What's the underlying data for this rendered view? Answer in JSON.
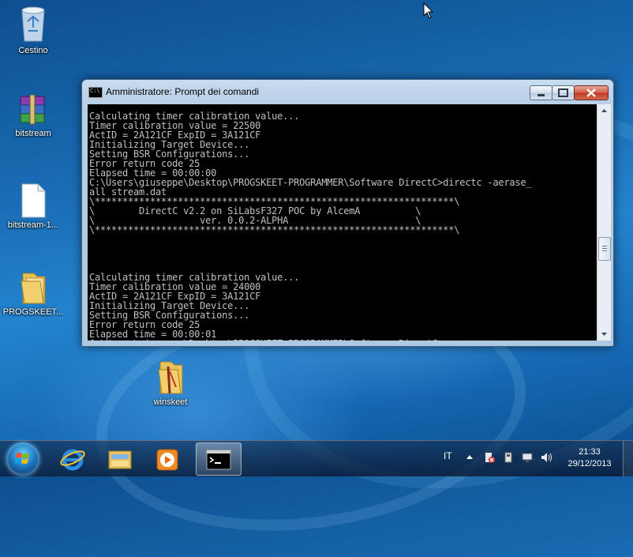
{
  "desktop": {
    "icons": [
      {
        "label": "Cestino",
        "icon": "recycle-bin-icon"
      },
      {
        "label": "bitstream",
        "icon": "winrar-archive-icon"
      },
      {
        "label": "bitstream-1...",
        "icon": "file-icon"
      },
      {
        "label": "PROGSKEET...",
        "icon": "folder-icon"
      },
      {
        "label": "winskeet",
        "icon": "zipped-folder-icon"
      }
    ]
  },
  "window": {
    "title": "Amministratore: Prompt dei comandi",
    "console_lines": [
      "Calculating timer calibration value...",
      "Timer calibration value = 22500",
      "ActID = 2A121CF ExpID = 3A121CF",
      "Initializing Target Device...",
      "Setting BSR Configurations...",
      "Error return code 25",
      "Elapsed time = 00:00:00",
      "C:\\Users\\giuseppe\\Desktop\\PROGSKEET-PROGRAMMER\\Software DirectC>directc -aerase_",
      "all stream.dat",
      "\\*****************************************************************\\",
      "\\        DirectC v2.2 on SiLabsF327 POC by AlcemA          \\",
      "\\                   ver. 0.0.2-ALPHA                       \\",
      "\\*****************************************************************\\",
      "",
      "",
      "",
      "",
      "Calculating timer calibration value...",
      "Timer calibration value = 24000",
      "ActID = 2A121CF ExpID = 3A121CF",
      "Initializing Target Device...",
      "Setting BSR Configurations...",
      "Error return code 25",
      "Elapsed time = 00:00:01",
      "C:\\Users\\giuseppe\\Desktop\\PROGSKEET-PROGRAMMER\\Software DirectC>"
    ]
  },
  "taskbar": {
    "pinned": [
      "internet-explorer-icon",
      "windows-explorer-icon",
      "media-player-icon",
      "command-prompt-icon"
    ],
    "language": "IT",
    "time": "21:33",
    "date": "29/12/2013"
  },
  "colors": {
    "console_text": "#c0c0c0",
    "console_bg": "#000000",
    "desktop_bg": "#1a6db5"
  }
}
